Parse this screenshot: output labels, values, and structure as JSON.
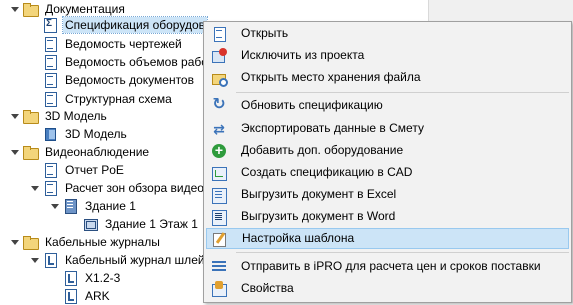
{
  "tree": {
    "items": [
      {
        "label": "Документация",
        "icon": "folder-icon"
      },
      {
        "label": "Спецификация оборудов",
        "icon": "specification-icon"
      },
      {
        "label": "Ведомость чертежей",
        "icon": "document-icon"
      },
      {
        "label": "Ведомость объемов рабо",
        "icon": "document-icon"
      },
      {
        "label": "Ведомость документов",
        "icon": "document-icon"
      },
      {
        "label": "Структурная схема",
        "icon": "document-icon"
      },
      {
        "label": "3D Модель",
        "icon": "folder-icon"
      },
      {
        "label": "3D Модель",
        "icon": "cube-icon"
      },
      {
        "label": "Видеонаблюдение",
        "icon": "folder-icon"
      },
      {
        "label": "Отчет PoE",
        "icon": "document-icon"
      },
      {
        "label": "Расчет зон обзора видео",
        "icon": "document-icon"
      },
      {
        "label": "Здание 1",
        "icon": "building-icon"
      },
      {
        "label": "Здание 1 Этаж 1",
        "icon": "floor-icon"
      },
      {
        "label": "Кабельные журналы",
        "icon": "folder-icon"
      },
      {
        "label": "Кабельный журнал шлей",
        "icon": "journal-icon"
      },
      {
        "label": "X1.2-3",
        "icon": "journal-icon"
      },
      {
        "label": "ARK",
        "icon": "journal-icon"
      }
    ]
  },
  "context_menu": {
    "items": [
      {
        "label": "Открыть",
        "icon": "open-icon"
      },
      {
        "label": "Исключить из проекта",
        "icon": "exclude-icon"
      },
      {
        "label": "Открыть место хранения файла",
        "icon": "folder-search-icon"
      },
      {
        "label": "Обновить спецификацию",
        "icon": "refresh-icon"
      },
      {
        "label": "Экспортировать данные в Смету",
        "icon": "export-icon"
      },
      {
        "label": "Добавить доп. оборудование",
        "icon": "add-icon"
      },
      {
        "label": "Создать спецификацию в CAD",
        "icon": "cad-icon"
      },
      {
        "label": "Выгрузить документ в Excel",
        "icon": "excel-icon"
      },
      {
        "label": "Выгрузить документ в Word",
        "icon": "word-icon"
      },
      {
        "label": "Настройка шаблона",
        "icon": "template-icon"
      },
      {
        "label": "Отправить в iPRO для расчета цен и сроков поставки",
        "icon": "ipro-icon"
      },
      {
        "label": "Свойства",
        "icon": "properties-icon"
      }
    ]
  },
  "colors": {
    "selection": "#cce4f7",
    "menu_background": "#f2f2f2",
    "highlight_border": "#99c9ef"
  }
}
